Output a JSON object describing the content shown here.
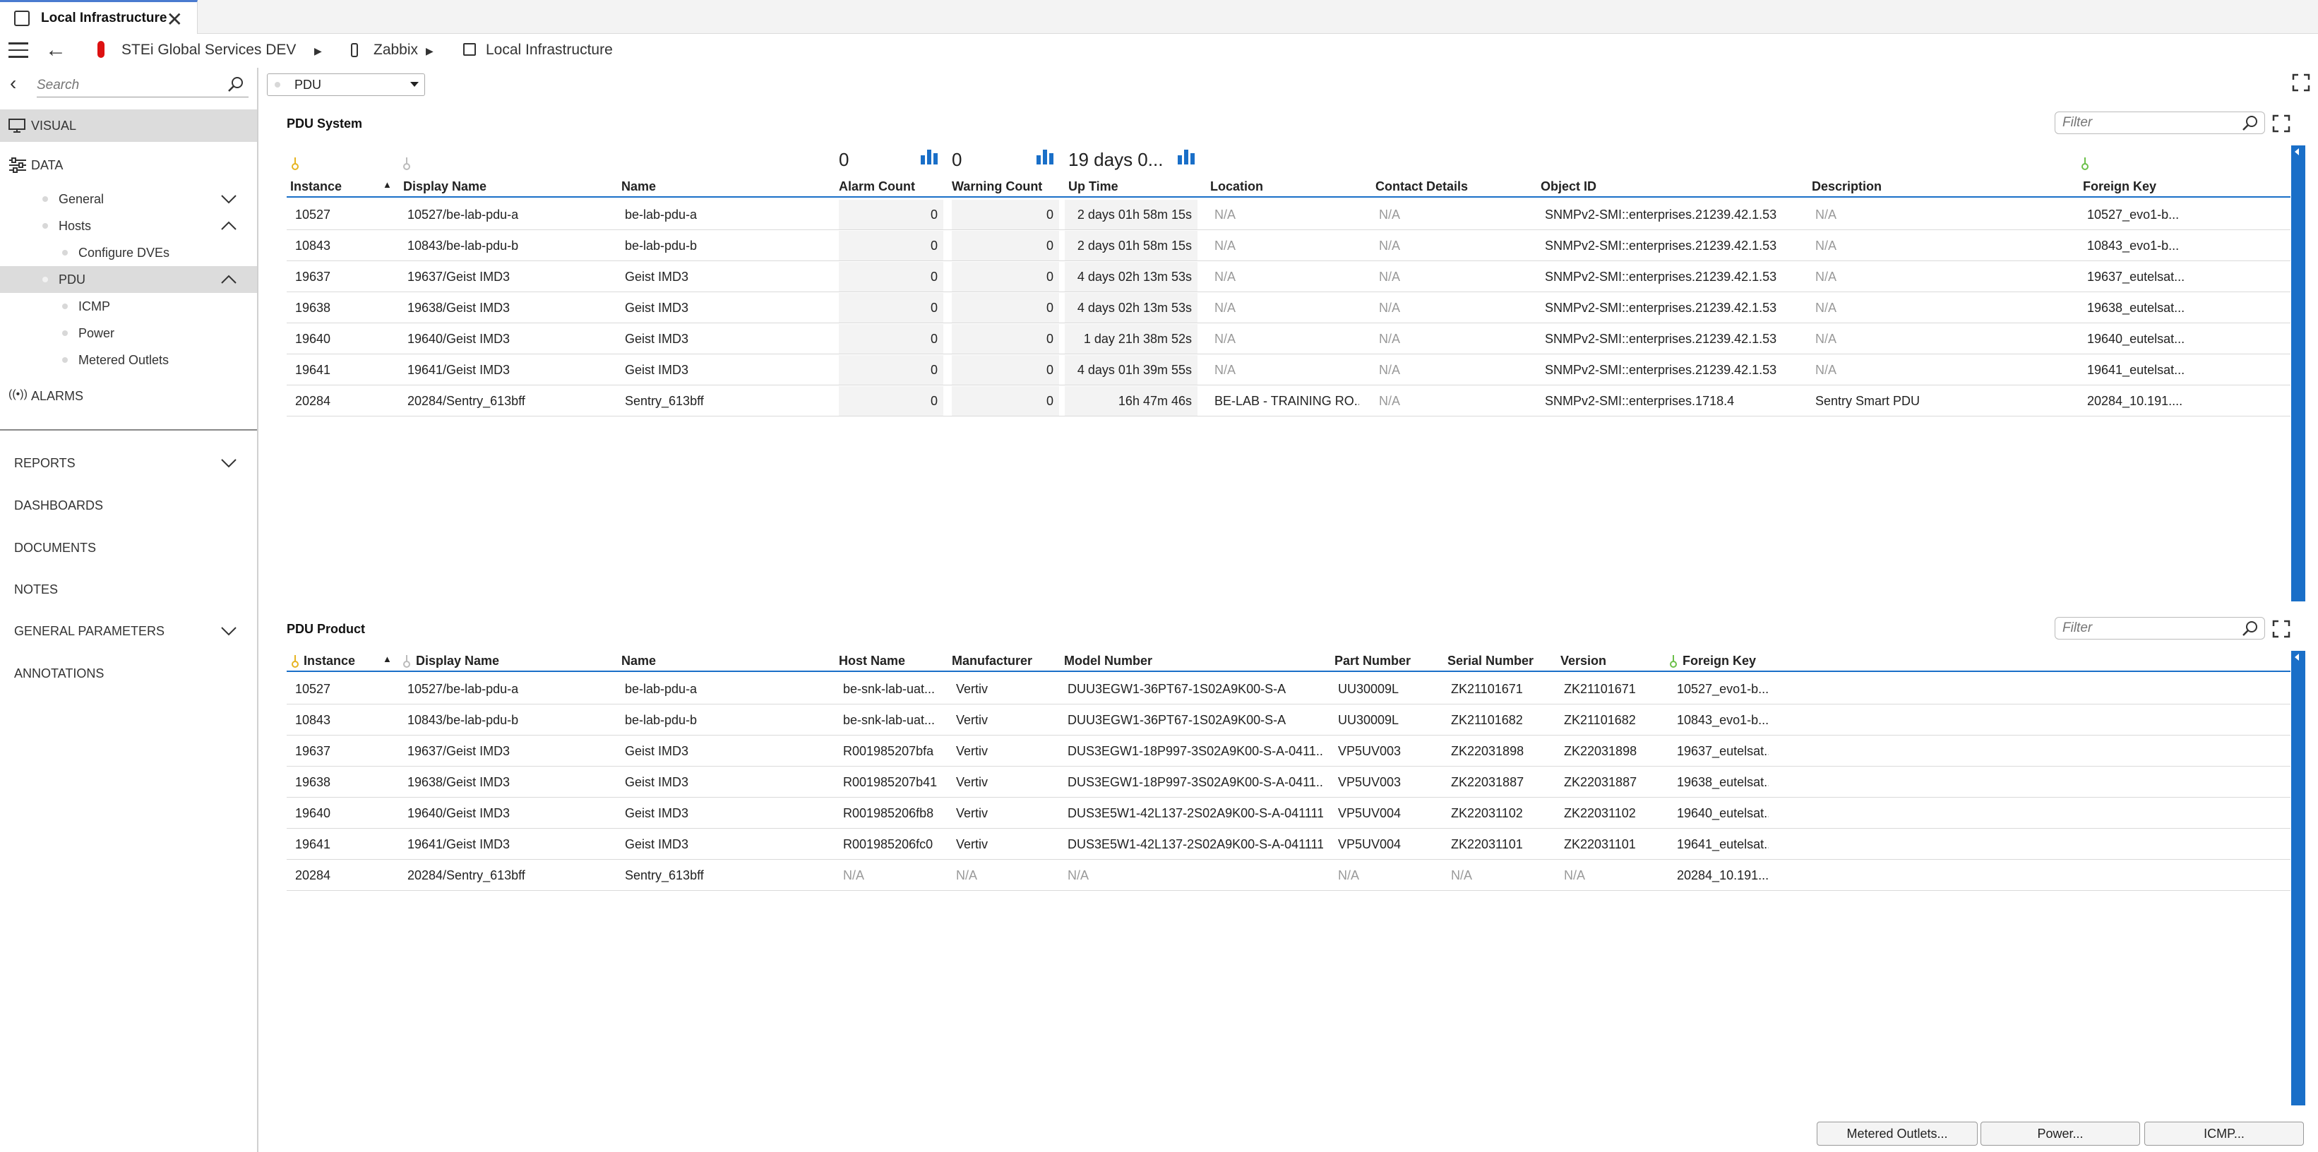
{
  "window": {
    "tab_title": "Local Infrastructure",
    "close_glyph": "✕"
  },
  "breadcrumb": [
    {
      "label": "STEi Global Services DEV"
    },
    {
      "label": "Zabbix"
    },
    {
      "label": "Local Infrastructure"
    }
  ],
  "sidebar": {
    "search_placeholder": "Search",
    "items": {
      "visual": "VISUAL",
      "data": "DATA",
      "general": "General",
      "hosts": "Hosts",
      "configure_dves": "Configure DVEs",
      "pdu": "PDU",
      "icmp": "ICMP",
      "power": "Power",
      "metered_outlets": "Metered Outlets",
      "alarms": "ALARMS",
      "reports": "REPORTS",
      "dashboards": "DASHBOARDS",
      "documents": "DOCUMENTS",
      "notes": "NOTES",
      "general_parameters": "GENERAL PARAMETERS",
      "annotations": "ANNOTATIONS"
    }
  },
  "view_select": {
    "value": "PDU"
  },
  "pdu_system": {
    "title": "PDU System",
    "filter_placeholder": "Filter",
    "summary": {
      "alarm_count": "0",
      "warning_count": "0",
      "up_time": "19 days 0..."
    },
    "headers": {
      "instance": "Instance",
      "display_name": "Display Name",
      "name": "Name",
      "alarm_count": "Alarm Count",
      "warning_count": "Warning Count",
      "up_time": "Up Time",
      "location": "Location",
      "contact_details": "Contact Details",
      "object_id": "Object ID",
      "description": "Description",
      "foreign_key": "Foreign Key"
    },
    "rows": [
      {
        "instance": "10527",
        "display_name": "10527/be-lab-pdu-a",
        "name": "be-lab-pdu-a",
        "alarm": "0",
        "warning": "0",
        "uptime": "2 days 01h 58m 15s",
        "location": "N/A",
        "contact": "N/A",
        "oid": "SNMPv2-SMI::enterprises.21239.42.1.53",
        "description": "N/A",
        "fkey": "10527_evo1-b..."
      },
      {
        "instance": "10843",
        "display_name": "10843/be-lab-pdu-b",
        "name": "be-lab-pdu-b",
        "alarm": "0",
        "warning": "0",
        "uptime": "2 days 01h 58m 15s",
        "location": "N/A",
        "contact": "N/A",
        "oid": "SNMPv2-SMI::enterprises.21239.42.1.53",
        "description": "N/A",
        "fkey": "10843_evo1-b..."
      },
      {
        "instance": "19637",
        "display_name": "19637/Geist IMD3",
        "name": "Geist IMD3",
        "alarm": "0",
        "warning": "0",
        "uptime": "4 days 02h 13m 53s",
        "location": "N/A",
        "contact": "N/A",
        "oid": "SNMPv2-SMI::enterprises.21239.42.1.53",
        "description": "N/A",
        "fkey": "19637_eutelsat..."
      },
      {
        "instance": "19638",
        "display_name": "19638/Geist IMD3",
        "name": "Geist IMD3",
        "alarm": "0",
        "warning": "0",
        "uptime": "4 days 02h 13m 53s",
        "location": "N/A",
        "contact": "N/A",
        "oid": "SNMPv2-SMI::enterprises.21239.42.1.53",
        "description": "N/A",
        "fkey": "19638_eutelsat..."
      },
      {
        "instance": "19640",
        "display_name": "19640/Geist IMD3",
        "name": "Geist IMD3",
        "alarm": "0",
        "warning": "0",
        "uptime": "1 day 21h 38m 52s",
        "location": "N/A",
        "contact": "N/A",
        "oid": "SNMPv2-SMI::enterprises.21239.42.1.53",
        "description": "N/A",
        "fkey": "19640_eutelsat..."
      },
      {
        "instance": "19641",
        "display_name": "19641/Geist IMD3",
        "name": "Geist IMD3",
        "alarm": "0",
        "warning": "0",
        "uptime": "4 days 01h 39m 55s",
        "location": "N/A",
        "contact": "N/A",
        "oid": "SNMPv2-SMI::enterprises.21239.42.1.53",
        "description": "N/A",
        "fkey": "19641_eutelsat..."
      },
      {
        "instance": "20284",
        "display_name": "20284/Sentry_613bff",
        "name": "Sentry_613bff",
        "alarm": "0",
        "warning": "0",
        "uptime": "16h 47m 46s",
        "location": "BE-LAB - TRAINING RO...",
        "contact": "N/A",
        "oid": "SNMPv2-SMI::enterprises.1718.4",
        "description": "Sentry Smart PDU",
        "fkey": "20284_10.191...."
      }
    ]
  },
  "pdu_product": {
    "title": "PDU Product",
    "filter_placeholder": "Filter",
    "headers": {
      "instance": "Instance",
      "display_name": "Display Name",
      "name": "Name",
      "host_name": "Host Name",
      "manufacturer": "Manufacturer",
      "model_number": "Model Number",
      "part_number": "Part Number",
      "serial_number": "Serial Number",
      "version": "Version",
      "foreign_key": "Foreign Key"
    },
    "rows": [
      {
        "instance": "10527",
        "display_name": "10527/be-lab-pdu-a",
        "name": "be-lab-pdu-a",
        "host": "be-snk-lab-uat...",
        "manufacturer": "Vertiv",
        "model": "DUU3EGW1-36PT67-1S02A9K00-S-A",
        "part": "UU30009L",
        "serial": "ZK21101671",
        "version": "ZK21101671",
        "fkey": "10527_evo1-b..."
      },
      {
        "instance": "10843",
        "display_name": "10843/be-lab-pdu-b",
        "name": "be-lab-pdu-b",
        "host": "be-snk-lab-uat...",
        "manufacturer": "Vertiv",
        "model": "DUU3EGW1-36PT67-1S02A9K00-S-A",
        "part": "UU30009L",
        "serial": "ZK21101682",
        "version": "ZK21101682",
        "fkey": "10843_evo1-b..."
      },
      {
        "instance": "19637",
        "display_name": "19637/Geist IMD3",
        "name": "Geist IMD3",
        "host": "R001985207bfa",
        "manufacturer": "Vertiv",
        "model": "DUS3EGW1-18P997-3S02A9K00-S-A-0411...",
        "part": "VP5UV003",
        "serial": "ZK22031898",
        "version": "ZK22031898",
        "fkey": "19637_eutelsat..."
      },
      {
        "instance": "19638",
        "display_name": "19638/Geist IMD3",
        "name": "Geist IMD3",
        "host": "R001985207b41",
        "manufacturer": "Vertiv",
        "model": "DUS3EGW1-18P997-3S02A9K00-S-A-0411...",
        "part": "VP5UV003",
        "serial": "ZK22031887",
        "version": "ZK22031887",
        "fkey": "19638_eutelsat..."
      },
      {
        "instance": "19640",
        "display_name": "19640/Geist IMD3",
        "name": "Geist IMD3",
        "host": "R001985206fb8",
        "manufacturer": "Vertiv",
        "model": "DUS3E5W1-42L137-2S02A9K00-S-A-041111",
        "part": "VP5UV004",
        "serial": "ZK22031102",
        "version": "ZK22031102",
        "fkey": "19640_eutelsat..."
      },
      {
        "instance": "19641",
        "display_name": "19641/Geist IMD3",
        "name": "Geist IMD3",
        "host": "R001985206fc0",
        "manufacturer": "Vertiv",
        "model": "DUS3E5W1-42L137-2S02A9K00-S-A-041111",
        "part": "VP5UV004",
        "serial": "ZK22031101",
        "version": "ZK22031101",
        "fkey": "19641_eutelsat..."
      },
      {
        "instance": "20284",
        "display_name": "20284/Sentry_613bff",
        "name": "Sentry_613bff",
        "host": "N/A",
        "manufacturer": "N/A",
        "model": "N/A",
        "part": "N/A",
        "serial": "N/A",
        "version": "N/A",
        "fkey": "20284_10.191...."
      }
    ]
  },
  "footer_buttons": {
    "metered_outlets": "Metered Outlets...",
    "power": "Power...",
    "icmp": "ICMP..."
  },
  "icons": [
    "hamburger-icon",
    "back-arrow-icon",
    "search-icon",
    "monitor-icon",
    "sliders-icon",
    "alarm-icon",
    "key-icon",
    "bar-chart-icon",
    "expand-icon",
    "chevron-down-icon",
    "chevron-up-icon"
  ],
  "colors": {
    "accent": "#1a6fc8",
    "brand_red": "#dd1111",
    "key_gold": "#e6b422",
    "key_green": "#6cc04a",
    "selected_bg": "#dcdcdc"
  }
}
